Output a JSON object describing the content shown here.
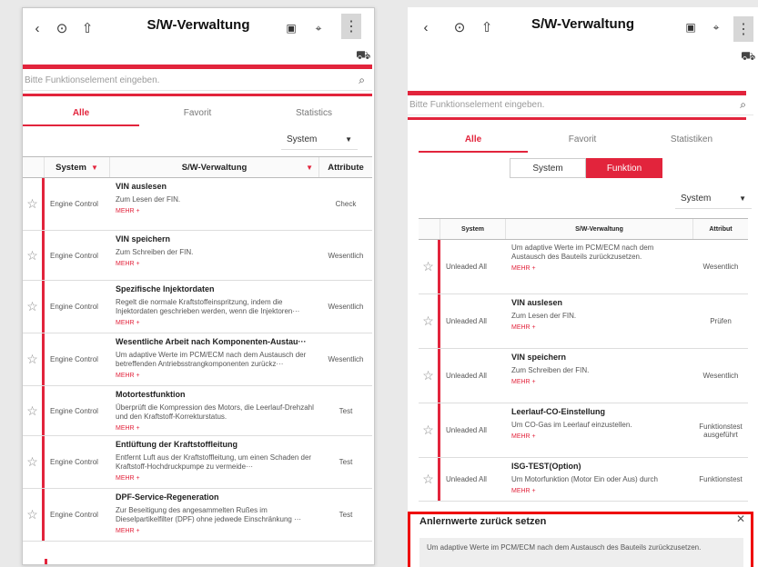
{
  "left": {
    "title": "S/W-Verwaltung",
    "search_placeholder": "Bitte Funktionselement eingeben.",
    "tabs": [
      "Alle",
      "Favorit",
      "Statistics"
    ],
    "select_value": "System",
    "columns": {
      "system": "System",
      "function": "S/W-Verwaltung",
      "attribute": "Attribute"
    },
    "more_label": "MEHR +",
    "rows": [
      {
        "system": "Engine Control",
        "name": "VIN auslesen",
        "desc": "Zum Lesen der FIN.",
        "attr": "Check"
      },
      {
        "system": "Engine Control",
        "name": "VIN speichern",
        "desc": "Zum Schreiben der FIN.",
        "attr": "Wesentlich"
      },
      {
        "system": "Engine Control",
        "name": "Spezifische Injektordaten",
        "desc": "Regelt die normale Kraftstoffeinspritzung, indem die Injektordaten geschrieben werden, wenn die Injektoren···",
        "attr": "Wesentlich"
      },
      {
        "system": "Engine Control",
        "name": "Wesentliche Arbeit nach Komponenten-Austau···",
        "desc": "Um adaptive Werte im PCM/ECM nach dem Austausch der betreffenden Antriebsstrangkomponenten zurückz···",
        "attr": "Wesentlich"
      },
      {
        "system": "Engine Control",
        "name": "Motortestfunktion",
        "desc": "Überprüft die Kompression des Motors, die Leerlauf-Drehzahl und den Kraftstoff-Korrekturstatus.",
        "attr": "Test"
      },
      {
        "system": "Engine Control",
        "name": "Entlüftung der Kraftstoffleitung",
        "desc": "Entfernt Luft aus der Kraftstoffleitung, um einen Schaden der Kraftstoff-Hochdruckpumpe zu vermeide···",
        "attr": "Test"
      },
      {
        "system": "Engine Control",
        "name": "DPF-Service-Regeneration",
        "desc": "Zur Beseitigung des angesammelten Rußes im Dieselpartikelfilter (DPF) ohne jedwede Einschränkung ···",
        "attr": "Test"
      }
    ]
  },
  "right": {
    "title": "S/W-Verwaltung",
    "search_placeholder": "Bitte Funktionselement eingeben.",
    "tabs": [
      "Alle",
      "Favorit",
      "Statistiken"
    ],
    "toggle": [
      "System",
      "Funktion"
    ],
    "select_value": "System",
    "columns": {
      "system": "System",
      "function": "S/W-Verwaltung",
      "attribute": "Attribut"
    },
    "more_label": "MEHR +",
    "rows": [
      {
        "system": "Unleaded All",
        "name": "",
        "desc": "Um adaptive Werte im PCM/ECM nach dem Austausch des Bauteils zurückzusetzen.",
        "attr": "Wesentlich"
      },
      {
        "system": "Unleaded All",
        "name": "VIN auslesen",
        "desc": "Zum Lesen der FIN.",
        "attr": "Prüfen"
      },
      {
        "system": "Unleaded All",
        "name": "VIN speichern",
        "desc": "Zum Schreiben der FIN.",
        "attr": "Wesentlich"
      },
      {
        "system": "Unleaded All",
        "name": "Leerlauf-CO-Einstellung",
        "desc": "Um CO-Gas im Leerlauf einzustellen.",
        "attr": "Funktionstest ausgeführt"
      },
      {
        "system": "Unleaded All",
        "name": "ISG-TEST(Option)",
        "desc": "Um Motorfunktion (Motor Ein oder Aus) durch",
        "attr": "Funktionstest"
      }
    ],
    "detail": {
      "title": "Anlernwerte zurück setzen",
      "text": "Um adaptive Werte im PCM/ECM nach dem Austausch des Bauteils zurückzusetzen."
    }
  },
  "colors": {
    "accent": "#e2243c",
    "highlight_box": "#ee0000"
  }
}
